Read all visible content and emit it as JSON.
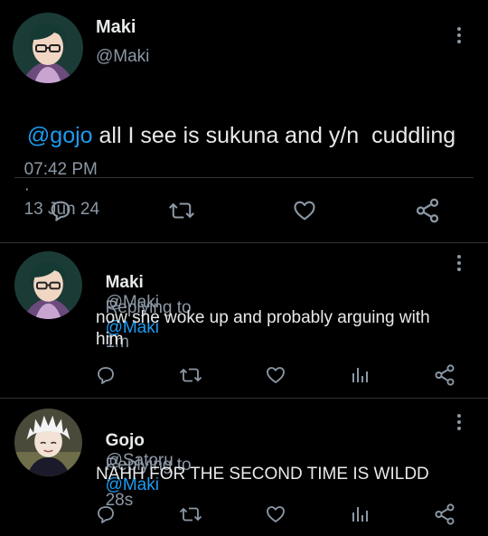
{
  "main_tweet": {
    "author_name": "Maki",
    "author_handle": "@Maki",
    "mention": "@gojo",
    "text": " all I see is sukuna and y/n  cuddling",
    "time": "07:42 PM",
    "separator": "·",
    "date": "13 Jun 24",
    "actions": [
      "reply-icon",
      "retweet-icon",
      "like-icon",
      "share-icon"
    ]
  },
  "replies": [
    {
      "author_name": "Maki",
      "author_handle": "@Maki",
      "separator": "·",
      "age": "1m",
      "replying_label": "Replying to",
      "replying_to": "@Maki",
      "text_line1": "now she woke up and probably arguing with",
      "text_line2": "him",
      "actions": [
        "reply-icon",
        "retweet-icon",
        "like-icon",
        "stats-icon",
        "share-icon"
      ]
    },
    {
      "author_name": "Gojo",
      "author_handle": "@Satoru",
      "separator": "·",
      "age": "28s",
      "replying_label": "Replying to",
      "replying_to": "@Maki",
      "text_line1": "NAHH FOR THE SECOND TIME IS WILDD",
      "actions": [
        "reply-icon",
        "retweet-icon",
        "like-icon",
        "stats-icon",
        "share-icon"
      ]
    }
  ],
  "colors": {
    "background": "#000000",
    "text": "#e7e9ea",
    "muted": "#8b98a5",
    "link": "#1d9bf0",
    "divider": "#2f3336"
  }
}
